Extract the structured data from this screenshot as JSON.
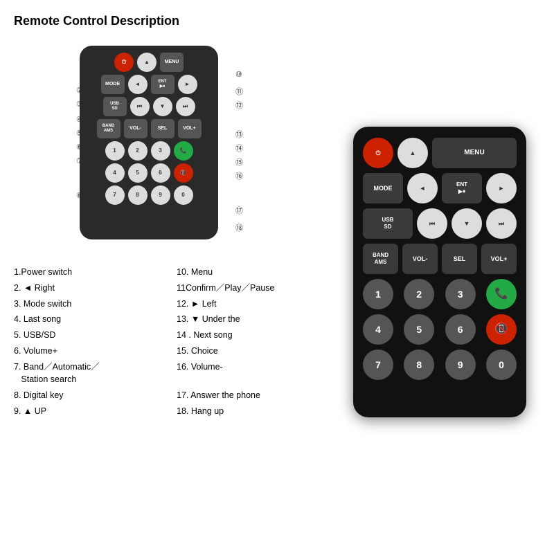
{
  "title": "Remote Control Description",
  "descriptions": [
    {
      "num": "1",
      "text": "1.Power switch"
    },
    {
      "num": "2",
      "text": "2. ◄ Right"
    },
    {
      "num": "3",
      "text": "3. Mode switch"
    },
    {
      "num": "4",
      "text": "4. Last song"
    },
    {
      "num": "5",
      "text": "5. USB/SD"
    },
    {
      "num": "6",
      "text": "6. Volume+"
    },
    {
      "num": "7",
      "text": "7. Band／Automatic／\n   Station search"
    },
    {
      "num": "8",
      "text": "8. Digital key"
    },
    {
      "num": "9",
      "text": "9. ▲ UP"
    },
    {
      "num": "10",
      "text": "10. Menu"
    },
    {
      "num": "11",
      "text": "11Confirm／Play／Pause"
    },
    {
      "num": "12",
      "text": "12. ► Left"
    },
    {
      "num": "13",
      "text": "13. ▼ Under the"
    },
    {
      "num": "14",
      "text": "14 . Next song"
    },
    {
      "num": "15",
      "text": "15. Choice"
    },
    {
      "num": "16",
      "text": "16. Volume-"
    },
    {
      "num": "17",
      "text": "17. Answer the phone"
    },
    {
      "num": "18",
      "text": "18. Hang up"
    }
  ],
  "remote": {
    "rows": [
      {
        "buttons": [
          {
            "label": "⏻",
            "type": "power",
            "title": "Power"
          },
          {
            "label": "▲",
            "type": "normal",
            "title": "UP"
          },
          {
            "label": "MENU",
            "type": "normal",
            "title": "Menu"
          }
        ]
      },
      {
        "buttons": [
          {
            "label": "MODE",
            "type": "normal",
            "title": "Mode"
          },
          {
            "label": "◄",
            "type": "normal",
            "title": "Left"
          },
          {
            "label": "ENT\n▶⏸",
            "type": "normal",
            "title": "ENT"
          },
          {
            "label": "►",
            "type": "normal",
            "title": "Right"
          }
        ]
      },
      {
        "buttons": [
          {
            "label": "USB\nSD",
            "type": "normal",
            "title": "USB/SD"
          },
          {
            "label": "⏮",
            "type": "normal",
            "title": "Last song"
          },
          {
            "label": "▼",
            "type": "normal",
            "title": "Down"
          },
          {
            "label": "⏭",
            "type": "normal",
            "title": "Next song"
          }
        ]
      },
      {
        "buttons": [
          {
            "label": "BAND\nAMS",
            "type": "normal",
            "title": "Band"
          },
          {
            "label": "VOL-",
            "type": "normal",
            "title": "Volume minus"
          },
          {
            "label": "SEL",
            "type": "normal",
            "title": "Select"
          },
          {
            "label": "VOL+",
            "type": "normal",
            "title": "Volume plus"
          }
        ]
      },
      {
        "buttons": [
          {
            "label": "1",
            "type": "num",
            "title": "1"
          },
          {
            "label": "2",
            "type": "num",
            "title": "2"
          },
          {
            "label": "3",
            "type": "num",
            "title": "3"
          },
          {
            "label": "📞",
            "type": "green",
            "title": "Answer"
          }
        ]
      },
      {
        "buttons": [
          {
            "label": "4",
            "type": "num",
            "title": "4"
          },
          {
            "label": "5",
            "type": "num",
            "title": "5"
          },
          {
            "label": "6",
            "type": "num",
            "title": "6"
          },
          {
            "label": "📵",
            "type": "red",
            "title": "Hang up"
          }
        ]
      },
      {
        "buttons": [
          {
            "label": "7",
            "type": "num",
            "title": "7"
          },
          {
            "label": "8",
            "type": "num",
            "title": "8"
          },
          {
            "label": "9",
            "type": "num",
            "title": "9"
          },
          {
            "label": "0",
            "type": "num",
            "title": "0"
          }
        ]
      }
    ]
  }
}
